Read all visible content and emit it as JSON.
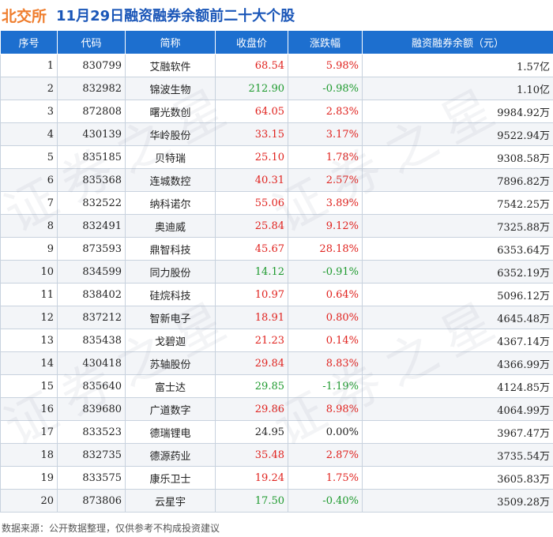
{
  "header": {
    "exchange": "北交所",
    "title": "11月29日融资融券余额前二十大个股"
  },
  "table": {
    "columns": [
      "序号",
      "代码",
      "简称",
      "收盘价",
      "涨跌幅",
      "融资融券余额（元）"
    ],
    "rows": [
      {
        "rank": "1",
        "code": "830799",
        "name": "艾融软件",
        "price": "68.54",
        "change": "5.98%",
        "dir": "up",
        "balance": "1.57亿"
      },
      {
        "rank": "2",
        "code": "832982",
        "name": "锦波生物",
        "price": "212.90",
        "change": "-0.98%",
        "dir": "down",
        "balance": "1.10亿"
      },
      {
        "rank": "3",
        "code": "872808",
        "name": "曙光数创",
        "price": "64.05",
        "change": "2.83%",
        "dir": "up",
        "balance": "9984.92万"
      },
      {
        "rank": "4",
        "code": "430139",
        "name": "华岭股份",
        "price": "33.15",
        "change": "3.17%",
        "dir": "up",
        "balance": "9522.94万"
      },
      {
        "rank": "5",
        "code": "835185",
        "name": "贝特瑞",
        "price": "25.10",
        "change": "1.78%",
        "dir": "up",
        "balance": "9308.58万"
      },
      {
        "rank": "6",
        "code": "835368",
        "name": "连城数控",
        "price": "40.31",
        "change": "2.57%",
        "dir": "up",
        "balance": "7896.82万"
      },
      {
        "rank": "7",
        "code": "832522",
        "name": "纳科诺尔",
        "price": "55.06",
        "change": "3.89%",
        "dir": "up",
        "balance": "7542.25万"
      },
      {
        "rank": "8",
        "code": "832491",
        "name": "奥迪威",
        "price": "25.84",
        "change": "9.12%",
        "dir": "up",
        "balance": "7325.88万"
      },
      {
        "rank": "9",
        "code": "873593",
        "name": "鼎智科技",
        "price": "45.67",
        "change": "28.18%",
        "dir": "up",
        "balance": "6353.64万"
      },
      {
        "rank": "10",
        "code": "834599",
        "name": "同力股份",
        "price": "14.12",
        "change": "-0.91%",
        "dir": "down",
        "balance": "6352.19万"
      },
      {
        "rank": "11",
        "code": "838402",
        "name": "硅烷科技",
        "price": "10.97",
        "change": "0.64%",
        "dir": "up",
        "balance": "5096.12万"
      },
      {
        "rank": "12",
        "code": "837212",
        "name": "智新电子",
        "price": "18.91",
        "change": "0.80%",
        "dir": "up",
        "balance": "4645.48万"
      },
      {
        "rank": "13",
        "code": "835438",
        "name": "戈碧迦",
        "price": "21.23",
        "change": "0.14%",
        "dir": "up",
        "balance": "4367.14万"
      },
      {
        "rank": "14",
        "code": "430418",
        "name": "苏轴股份",
        "price": "29.84",
        "change": "8.83%",
        "dir": "up",
        "balance": "4366.99万"
      },
      {
        "rank": "15",
        "code": "835640",
        "name": "富士达",
        "price": "29.85",
        "change": "-1.19%",
        "dir": "down",
        "balance": "4124.85万"
      },
      {
        "rank": "16",
        "code": "839680",
        "name": "广道数字",
        "price": "29.86",
        "change": "8.98%",
        "dir": "up",
        "balance": "4064.99万"
      },
      {
        "rank": "17",
        "code": "833523",
        "name": "德瑞锂电",
        "price": "24.95",
        "change": "0.00%",
        "dir": "flat",
        "balance": "3967.47万"
      },
      {
        "rank": "18",
        "code": "832735",
        "name": "德源药业",
        "price": "35.48",
        "change": "2.87%",
        "dir": "up",
        "balance": "3735.54万"
      },
      {
        "rank": "19",
        "code": "833575",
        "name": "康乐卫士",
        "price": "19.24",
        "change": "1.75%",
        "dir": "up",
        "balance": "3605.83万"
      },
      {
        "rank": "20",
        "code": "873806",
        "name": "云星宇",
        "price": "17.50",
        "change": "-0.40%",
        "dir": "down",
        "balance": "3509.28万"
      }
    ]
  },
  "footer": {
    "source": "数据来源：公开数据整理，仅供参考不构成投资建议"
  },
  "watermark": {
    "text": "证券之星"
  },
  "colors": {
    "header_bg": "#1d6fcf",
    "title": "#1a56b8",
    "exchange": "#ef7d2d",
    "up": "#e0221e",
    "down": "#1e9a2e"
  }
}
